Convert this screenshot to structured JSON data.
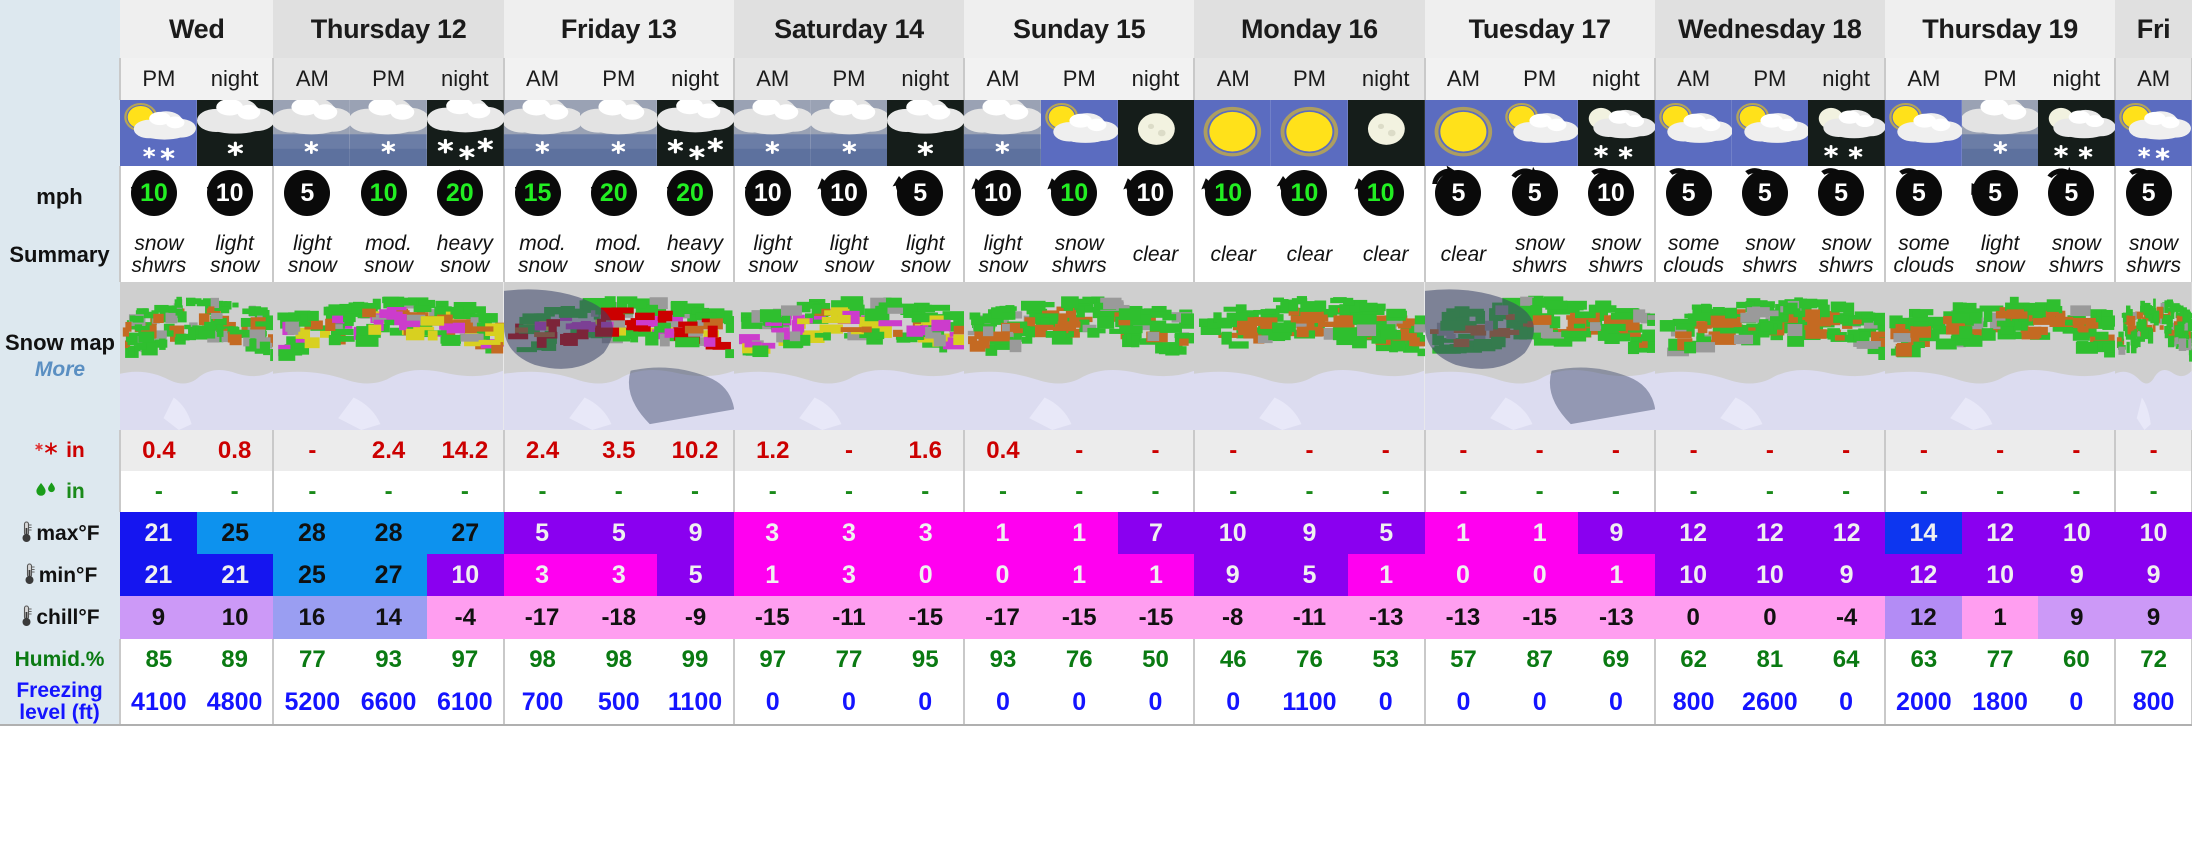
{
  "row_labels": {
    "wind": "mph",
    "summary": "Summary",
    "snow_map": "Snow map",
    "snow_map_more": "More",
    "snow_in": "in",
    "rain_in": "in",
    "max_f": "max°F",
    "min_f": "min°F",
    "chill_f": "chill°F",
    "humidity": "Humid.%",
    "freezing_level_1": "Freezing",
    "freezing_level_2": "level (ft)"
  },
  "days": [
    {
      "label": "Wed",
      "periods": [
        "PM",
        "night"
      ]
    },
    {
      "label": "Thursday 12",
      "periods": [
        "AM",
        "PM",
        "night"
      ]
    },
    {
      "label": "Friday 13",
      "periods": [
        "AM",
        "PM",
        "night"
      ]
    },
    {
      "label": "Saturday 14",
      "periods": [
        "AM",
        "PM",
        "night"
      ]
    },
    {
      "label": "Sunday 15",
      "periods": [
        "AM",
        "PM",
        "night"
      ]
    },
    {
      "label": "Monday 16",
      "periods": [
        "AM",
        "PM",
        "night"
      ]
    },
    {
      "label": "Tuesday 17",
      "periods": [
        "AM",
        "PM",
        "night"
      ]
    },
    {
      "label": "Wednesday 18",
      "periods": [
        "AM",
        "PM",
        "night"
      ]
    },
    {
      "label": "Thursday 19",
      "periods": [
        "AM",
        "PM",
        "night"
      ]
    },
    {
      "label": "Fri",
      "periods": [
        "AM"
      ]
    }
  ],
  "columns": [
    {
      "day": 0,
      "period": "PM",
      "icon": "sun-cloud-snow",
      "icon_bg": "day",
      "wind": "10",
      "wind_color": "green",
      "wind_dir": 135,
      "summary": [
        "snow",
        "shwrs"
      ],
      "snow_in": "0.4",
      "rain_in": "-",
      "max_f": "21",
      "max_bg": "#1515f0",
      "max_fg": "#f0f0f0",
      "min_f": "21",
      "min_bg": "#1515f0",
      "min_fg": "#f0f0f0",
      "chill_f": "9",
      "chill_bg": "#cc99f7",
      "humidity": "85",
      "freezing": "4100"
    },
    {
      "day": 0,
      "period": "night",
      "icon": "night-cloud-snow",
      "icon_bg": "night",
      "wind": "10",
      "wind_color": "white",
      "wind_dir": 135,
      "summary": [
        "light",
        "snow"
      ],
      "snow_in": "0.8",
      "rain_in": "-",
      "max_f": "25",
      "max_bg": "#0d92ee",
      "max_fg": "#101010",
      "min_f": "21",
      "min_bg": "#1515f0",
      "min_fg": "#f0f0f0",
      "chill_f": "10",
      "chill_bg": "#cc99f7",
      "humidity": "89",
      "freezing": "4800"
    },
    {
      "day": 1,
      "period": "AM",
      "icon": "cloud-snow",
      "icon_bg": "dim",
      "wind": "5",
      "wind_color": "white",
      "wind_dir": 110,
      "summary": [
        "light",
        "snow"
      ],
      "snow_in": "-",
      "rain_in": "-",
      "max_f": "28",
      "max_bg": "#0d92ee",
      "max_fg": "#101010",
      "min_f": "25",
      "min_bg": "#0d92ee",
      "min_fg": "#101010",
      "chill_f": "16",
      "chill_bg": "#9a9ef2",
      "humidity": "77",
      "freezing": "5200"
    },
    {
      "day": 1,
      "period": "PM",
      "icon": "cloud-snow",
      "icon_bg": "dim",
      "wind": "10",
      "wind_color": "green",
      "wind_dir": 40,
      "summary": [
        "mod.",
        "snow"
      ],
      "snow_in": "2.4",
      "rain_in": "-",
      "max_f": "28",
      "max_bg": "#0d92ee",
      "max_fg": "#101010",
      "min_f": "27",
      "min_bg": "#0d92ee",
      "min_fg": "#101010",
      "chill_f": "14",
      "chill_bg": "#9a9ef2",
      "humidity": "93",
      "freezing": "6600"
    },
    {
      "day": 1,
      "period": "night",
      "icon": "night-heavy-snow",
      "icon_bg": "night",
      "wind": "20",
      "wind_color": "green",
      "wind_dir": 30,
      "summary": [
        "heavy",
        "snow"
      ],
      "snow_in": "14.2",
      "rain_in": "-",
      "max_f": "27",
      "max_bg": "#0d92ee",
      "max_fg": "#101010",
      "min_f": "10",
      "min_bg": "#8a00f0",
      "min_fg": "#f0f0f0",
      "chill_f": "-4",
      "chill_bg": "#ff9ef0",
      "humidity": "97",
      "freezing": "6100"
    },
    {
      "day": 2,
      "period": "AM",
      "icon": "cloud-snow",
      "icon_bg": "dim",
      "wind": "15",
      "wind_color": "green",
      "wind_dir": 135,
      "summary": [
        "mod.",
        "snow"
      ],
      "snow_in": "2.4",
      "rain_in": "-",
      "max_f": "5",
      "max_bg": "#8a00f0",
      "max_fg": "#f0f0f0",
      "min_f": "3",
      "min_bg": "#ff00f0",
      "min_fg": "#f0f0f0",
      "chill_f": "-17",
      "chill_bg": "#ff9ef0",
      "humidity": "98",
      "freezing": "700"
    },
    {
      "day": 2,
      "period": "PM",
      "icon": "cloud-snow",
      "icon_bg": "dim",
      "wind": "20",
      "wind_color": "green",
      "wind_dir": 135,
      "summary": [
        "mod.",
        "snow"
      ],
      "snow_in": "3.5",
      "rain_in": "-",
      "max_f": "5",
      "max_bg": "#8a00f0",
      "max_fg": "#f0f0f0",
      "min_f": "3",
      "min_bg": "#ff00f0",
      "min_fg": "#f0f0f0",
      "chill_f": "-18",
      "chill_bg": "#ff9ef0",
      "humidity": "98",
      "freezing": "500"
    },
    {
      "day": 2,
      "period": "night",
      "icon": "night-heavy-snow",
      "icon_bg": "night",
      "wind": "20",
      "wind_color": "green",
      "wind_dir": 135,
      "summary": [
        "heavy",
        "snow"
      ],
      "snow_in": "10.2",
      "rain_in": "-",
      "max_f": "9",
      "max_bg": "#8a00f0",
      "max_fg": "#f0f0f0",
      "min_f": "5",
      "min_bg": "#8a00f0",
      "min_fg": "#f0f0f0",
      "chill_f": "-9",
      "chill_bg": "#ff9ef0",
      "humidity": "99",
      "freezing": "1100"
    },
    {
      "day": 3,
      "period": "AM",
      "icon": "cloud-snow",
      "icon_bg": "dim",
      "wind": "10",
      "wind_color": "white",
      "wind_dir": 135,
      "summary": [
        "light",
        "snow"
      ],
      "snow_in": "1.2",
      "rain_in": "-",
      "max_f": "3",
      "max_bg": "#ff00f0",
      "max_fg": "#f0f0f0",
      "min_f": "1",
      "min_bg": "#ff00f0",
      "min_fg": "#f0f0f0",
      "chill_f": "-15",
      "chill_bg": "#ff9ef0",
      "humidity": "97",
      "freezing": "0"
    },
    {
      "day": 3,
      "period": "PM",
      "icon": "cloud-snow",
      "icon_bg": "dim",
      "wind": "10",
      "wind_color": "white",
      "wind_dir": 170,
      "summary": [
        "light",
        "snow"
      ],
      "snow_in": "-",
      "rain_in": "-",
      "max_f": "3",
      "max_bg": "#ff00f0",
      "max_fg": "#f0f0f0",
      "min_f": "3",
      "min_bg": "#ff00f0",
      "min_fg": "#f0f0f0",
      "chill_f": "-11",
      "chill_bg": "#ff9ef0",
      "humidity": "77",
      "freezing": "0"
    },
    {
      "day": 3,
      "period": "night",
      "icon": "night-cloud-snow",
      "icon_bg": "night",
      "wind": "5",
      "wind_color": "white",
      "wind_dir": 180,
      "summary": [
        "light",
        "snow"
      ],
      "snow_in": "1.6",
      "rain_in": "-",
      "max_f": "3",
      "max_bg": "#ff00f0",
      "max_fg": "#f0f0f0",
      "min_f": "0",
      "min_bg": "#ff00f0",
      "min_fg": "#f0f0f0",
      "chill_f": "-15",
      "chill_bg": "#ff9ef0",
      "humidity": "95",
      "freezing": "0"
    },
    {
      "day": 4,
      "period": "AM",
      "icon": "cloud-snow",
      "icon_bg": "dim",
      "wind": "10",
      "wind_color": "white",
      "wind_dir": 170,
      "summary": [
        "light",
        "snow"
      ],
      "snow_in": "0.4",
      "rain_in": "-",
      "max_f": "1",
      "max_bg": "#ff00f0",
      "max_fg": "#f0f0f0",
      "min_f": "0",
      "min_bg": "#ff00f0",
      "min_fg": "#f0f0f0",
      "chill_f": "-17",
      "chill_bg": "#ff9ef0",
      "humidity": "93",
      "freezing": "0"
    },
    {
      "day": 4,
      "period": "PM",
      "icon": "sun-cloud",
      "icon_bg": "day",
      "wind": "10",
      "wind_color": "green",
      "wind_dir": 170,
      "summary": [
        "snow",
        "shwrs"
      ],
      "snow_in": "-",
      "rain_in": "-",
      "max_f": "1",
      "max_bg": "#ff00f0",
      "max_fg": "#f0f0f0",
      "min_f": "1",
      "min_bg": "#ff00f0",
      "min_fg": "#f0f0f0",
      "chill_f": "-15",
      "chill_bg": "#ff9ef0",
      "humidity": "76",
      "freezing": "0"
    },
    {
      "day": 4,
      "period": "night",
      "icon": "moon-clear",
      "icon_bg": "night",
      "wind": "10",
      "wind_color": "white",
      "wind_dir": 170,
      "summary": [
        "clear"
      ],
      "snow_in": "-",
      "rain_in": "-",
      "max_f": "7",
      "max_bg": "#8a00f0",
      "max_fg": "#f0f0f0",
      "min_f": "1",
      "min_bg": "#ff00f0",
      "min_fg": "#f0f0f0",
      "chill_f": "-15",
      "chill_bg": "#ff9ef0",
      "humidity": "50",
      "freezing": "0"
    },
    {
      "day": 5,
      "period": "AM",
      "icon": "sun-clear",
      "icon_bg": "day",
      "wind": "10",
      "wind_color": "green",
      "wind_dir": 170,
      "summary": [
        "clear"
      ],
      "snow_in": "-",
      "rain_in": "-",
      "max_f": "10",
      "max_bg": "#8a00f0",
      "max_fg": "#f0f0f0",
      "min_f": "9",
      "min_bg": "#8a00f0",
      "min_fg": "#f0f0f0",
      "chill_f": "-8",
      "chill_bg": "#ff9ef0",
      "humidity": "46",
      "freezing": "0"
    },
    {
      "day": 5,
      "period": "PM",
      "icon": "sun-clear",
      "icon_bg": "day",
      "wind": "10",
      "wind_color": "green",
      "wind_dir": 180,
      "summary": [
        "clear"
      ],
      "snow_in": "-",
      "rain_in": "-",
      "max_f": "9",
      "max_bg": "#8a00f0",
      "max_fg": "#f0f0f0",
      "min_f": "5",
      "min_bg": "#8a00f0",
      "min_fg": "#f0f0f0",
      "chill_f": "-11",
      "chill_bg": "#ff9ef0",
      "humidity": "76",
      "freezing": "1100"
    },
    {
      "day": 5,
      "period": "night",
      "icon": "moon-clear",
      "icon_bg": "night",
      "wind": "10",
      "wind_color": "green",
      "wind_dir": 170,
      "summary": [
        "clear"
      ],
      "snow_in": "-",
      "rain_in": "-",
      "max_f": "5",
      "max_bg": "#8a00f0",
      "max_fg": "#f0f0f0",
      "min_f": "1",
      "min_bg": "#ff00f0",
      "min_fg": "#f0f0f0",
      "chill_f": "-13",
      "chill_bg": "#ff9ef0",
      "humidity": "53",
      "freezing": "0"
    },
    {
      "day": 6,
      "period": "AM",
      "icon": "sun-clear",
      "icon_bg": "day",
      "wind": "5",
      "wind_color": "white",
      "wind_dir": 270,
      "summary": [
        "clear"
      ],
      "snow_in": "-",
      "rain_in": "-",
      "max_f": "1",
      "max_bg": "#ff00f0",
      "max_fg": "#f0f0f0",
      "min_f": "0",
      "min_bg": "#ff00f0",
      "min_fg": "#f0f0f0",
      "chill_f": "-13",
      "chill_bg": "#ff9ef0",
      "humidity": "57",
      "freezing": "0"
    },
    {
      "day": 6,
      "period": "PM",
      "icon": "sun-cloud",
      "icon_bg": "day",
      "wind": "5",
      "wind_color": "white",
      "wind_dir": 300,
      "summary": [
        "snow",
        "shwrs"
      ],
      "snow_in": "-",
      "rain_in": "-",
      "max_f": "1",
      "max_bg": "#ff00f0",
      "max_fg": "#f0f0f0",
      "min_f": "0",
      "min_bg": "#ff00f0",
      "min_fg": "#f0f0f0",
      "chill_f": "-15",
      "chill_bg": "#ff9ef0",
      "humidity": "87",
      "freezing": "0"
    },
    {
      "day": 6,
      "period": "night",
      "icon": "moon-cloud-snow",
      "icon_bg": "night",
      "wind": "10",
      "wind_color": "white",
      "wind_dir": 320,
      "summary": [
        "snow",
        "shwrs"
      ],
      "snow_in": "-",
      "rain_in": "-",
      "max_f": "9",
      "max_bg": "#8a00f0",
      "max_fg": "#f0f0f0",
      "min_f": "1",
      "min_bg": "#ff00f0",
      "min_fg": "#f0f0f0",
      "chill_f": "-13",
      "chill_bg": "#ff9ef0",
      "humidity": "69",
      "freezing": "0"
    },
    {
      "day": 7,
      "period": "AM",
      "icon": "sun-cloud",
      "icon_bg": "day",
      "wind": "5",
      "wind_color": "white",
      "wind_dir": 320,
      "summary": [
        "some",
        "clouds"
      ],
      "snow_in": "-",
      "rain_in": "-",
      "max_f": "12",
      "max_bg": "#8a00f0",
      "max_fg": "#f0f0f0",
      "min_f": "10",
      "min_bg": "#8a00f0",
      "min_fg": "#f0f0f0",
      "chill_f": "0",
      "chill_bg": "#ff9ef0",
      "humidity": "62",
      "freezing": "800"
    },
    {
      "day": 7,
      "period": "PM",
      "icon": "sun-cloud",
      "icon_bg": "day",
      "wind": "5",
      "wind_color": "white",
      "wind_dir": 320,
      "summary": [
        "snow",
        "shwrs"
      ],
      "snow_in": "-",
      "rain_in": "-",
      "max_f": "12",
      "max_bg": "#8a00f0",
      "max_fg": "#f0f0f0",
      "min_f": "10",
      "min_bg": "#8a00f0",
      "min_fg": "#f0f0f0",
      "chill_f": "0",
      "chill_bg": "#ff9ef0",
      "humidity": "81",
      "freezing": "2600"
    },
    {
      "day": 7,
      "period": "night",
      "icon": "moon-cloud-snow",
      "icon_bg": "night",
      "wind": "5",
      "wind_color": "white",
      "wind_dir": 320,
      "summary": [
        "snow",
        "shwrs"
      ],
      "snow_in": "-",
      "rain_in": "-",
      "max_f": "12",
      "max_bg": "#8a00f0",
      "max_fg": "#f0f0f0",
      "min_f": "9",
      "min_bg": "#8a00f0",
      "min_fg": "#f0f0f0",
      "chill_f": "-4",
      "chill_bg": "#ff9ef0",
      "humidity": "64",
      "freezing": "0"
    },
    {
      "day": 8,
      "period": "AM",
      "icon": "sun-cloud",
      "icon_bg": "day",
      "wind": "5",
      "wind_color": "white",
      "wind_dir": 320,
      "summary": [
        "some",
        "clouds"
      ],
      "snow_in": "-",
      "rain_in": "-",
      "max_f": "14",
      "max_bg": "#0d36f0",
      "max_fg": "#f0f0f0",
      "min_f": "12",
      "min_bg": "#8a00f0",
      "min_fg": "#f0f0f0",
      "chill_f": "12",
      "chill_bg": "#b38cf5",
      "humidity": "63",
      "freezing": "2000"
    },
    {
      "day": 8,
      "period": "PM",
      "icon": "cloud-snow",
      "icon_bg": "dim",
      "wind": "5",
      "wind_color": "white",
      "wind_dir": 150,
      "summary": [
        "light",
        "snow"
      ],
      "snow_in": "-",
      "rain_in": "-",
      "max_f": "12",
      "max_bg": "#8a00f0",
      "max_fg": "#f0f0f0",
      "min_f": "10",
      "min_bg": "#8a00f0",
      "min_fg": "#f0f0f0",
      "chill_f": "1",
      "chill_bg": "#ff9ef0",
      "humidity": "77",
      "freezing": "1800"
    },
    {
      "day": 8,
      "period": "night",
      "icon": "moon-cloud-snow",
      "icon_bg": "night",
      "wind": "5",
      "wind_color": "white",
      "wind_dir": 300,
      "summary": [
        "snow",
        "shwrs"
      ],
      "snow_in": "-",
      "rain_in": "-",
      "max_f": "10",
      "max_bg": "#8a00f0",
      "max_fg": "#f0f0f0",
      "min_f": "9",
      "min_bg": "#8a00f0",
      "min_fg": "#f0f0f0",
      "chill_f": "9",
      "chill_bg": "#cc99f7",
      "humidity": "60",
      "freezing": "0"
    },
    {
      "day": 9,
      "period": "AM",
      "icon": "sun-cloud-snow",
      "icon_bg": "day",
      "wind": "5",
      "wind_color": "white",
      "wind_dir": 320,
      "summary": [
        "snow",
        "shwrs"
      ],
      "snow_in": "-",
      "rain_in": "-",
      "max_f": "10",
      "max_bg": "#8a00f0",
      "max_fg": "#f0f0f0",
      "min_f": "9",
      "min_bg": "#8a00f0",
      "min_fg": "#f0f0f0",
      "chill_f": "9",
      "chill_bg": "#cc99f7",
      "humidity": "72",
      "freezing": "800"
    }
  ],
  "colors": {
    "label_bg": "#dde8ef",
    "snow_text": "#cc0000",
    "rain_text": "#1a8a1a",
    "humidity_text": "#0a7a12",
    "freezing_text": "#1414ff",
    "wind_green": "#22ee22",
    "wind_white": "#ffffff",
    "more_link": "#5a8fc2"
  }
}
